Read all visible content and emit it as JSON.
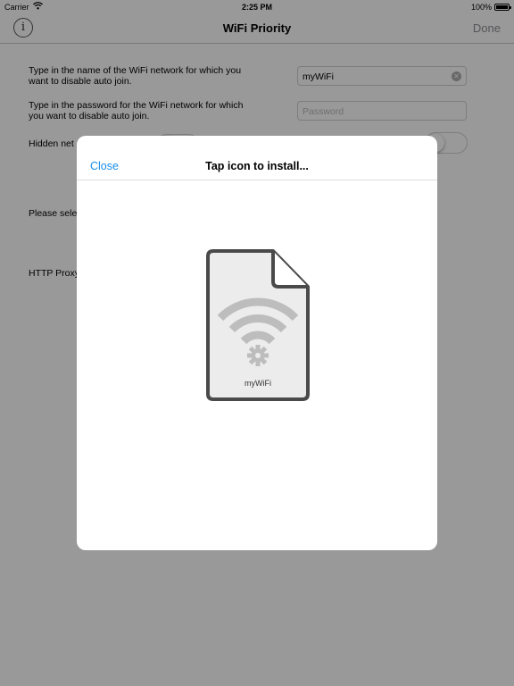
{
  "status_bar": {
    "carrier": "Carrier",
    "time": "2:25 PM",
    "battery": "100%"
  },
  "nav": {
    "title": "WiFi Priority",
    "done_label": "Done",
    "info_glyph": "i"
  },
  "form": {
    "ssid_label": "Type in the name of the WiFi network for which you want to disable auto join.",
    "ssid_value": "myWiFi",
    "password_label": "Type in the password for the WiFi network for which you want to disable auto join.",
    "password_placeholder": "Password",
    "hidden_label": "Hidden net",
    "select_label": "Please sele",
    "proxy_label": "HTTP Proxy"
  },
  "modal": {
    "close_label": "Close",
    "title": "Tap icon to install...",
    "file_label": "myWiFi"
  },
  "icons": [
    "wifi-icon",
    "battery-icon",
    "info-icon",
    "clear-icon",
    "profile-file-icon",
    "gear-icon"
  ],
  "colors": {
    "accent": "#1a8ee6",
    "done_disabled": "#8e8e93",
    "icon_stroke": "#4a4a4a",
    "icon_fill": "#bdbdbd"
  }
}
